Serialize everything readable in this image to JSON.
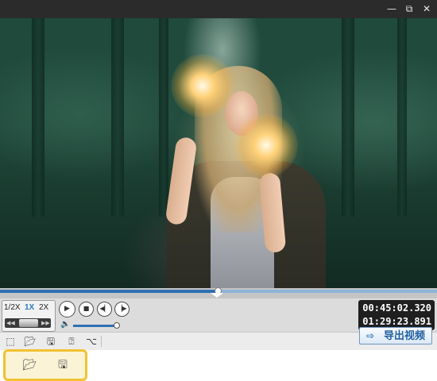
{
  "window": {
    "minimize_icon": "minimize-icon",
    "maximize_icon": "maximize-icon",
    "close_icon": "close-icon"
  },
  "video": {
    "description_icon": "video-frame"
  },
  "seek": {
    "progress": 0.5
  },
  "speed": {
    "options": [
      "1/2X",
      "1X",
      "2X"
    ],
    "selected": "1X",
    "rewind_icon": "rewind-icon",
    "fast_forward_icon": "fast-forward-icon"
  },
  "playback": {
    "play_icon": "play-icon",
    "stop_icon": "stop-icon",
    "prev_icon": "previous-icon",
    "next_icon": "next-icon"
  },
  "volume": {
    "icon": "volume-icon",
    "level": 0.95
  },
  "time": {
    "current": "00:45:02.320",
    "total": "01:29:23.891"
  },
  "toolbar": {
    "icons": [
      "subtitle-icon",
      "open-folder-icon",
      "save-icon",
      "help-icon",
      "share-icon"
    ]
  },
  "export": {
    "label": "导出视频",
    "icon": "export-icon"
  },
  "callout": {
    "icons": [
      "open-folder-icon",
      "save-icon"
    ]
  },
  "colors": {
    "accent": "#2e6fb4",
    "highlight": "#f2c230",
    "titlebar": "#2b2b2b"
  }
}
